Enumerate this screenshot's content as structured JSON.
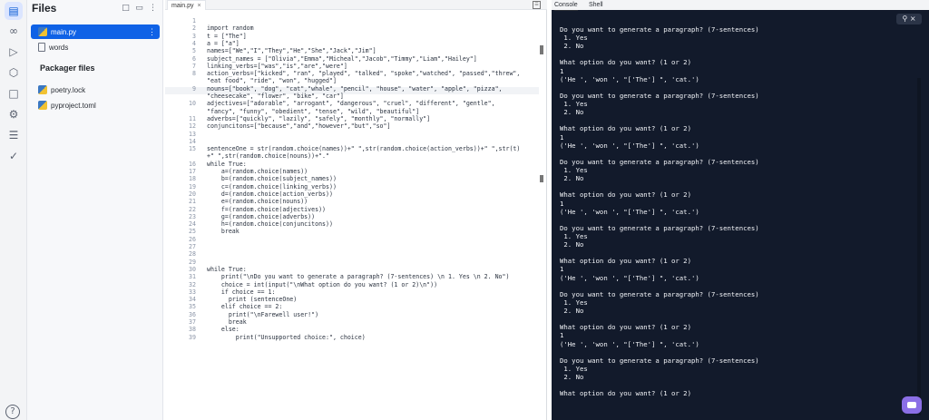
{
  "files": {
    "title": "Files",
    "items": [
      {
        "name": "main.py",
        "active": true
      },
      {
        "name": "words",
        "active": false
      }
    ],
    "packager_title": "Packager files",
    "packager_items": [
      {
        "name": "poetry.lock"
      },
      {
        "name": "pyproject.toml"
      }
    ]
  },
  "editor": {
    "tab_label": "main.py",
    "lines": [
      {
        "n": "1",
        "t": ""
      },
      {
        "n": "2",
        "t": "import random"
      },
      {
        "n": "3",
        "t": "t = [\"The\"]"
      },
      {
        "n": "4",
        "t": "a = [\"a\"]"
      },
      {
        "n": "5",
        "t": "names=[\"We\",\"I\",\"They\",\"He\",\"She\",\"Jack\",\"Jim\"]"
      },
      {
        "n": "6",
        "t": "subject_names = [\"Olivia\",\"Emma\",\"Micheal\",\"Jacob\",\"Timmy\",\"Liam\",\"Hailey\"]"
      },
      {
        "n": "7",
        "t": "linking_verbs=[\"was\",\"is\",\"are\",\"were\"]"
      },
      {
        "n": "8",
        "t": "action_verbs=[\"kicked\", \"ran\", \"played\", \"talked\", \"spoke\",\"watched\", \"passed\",\"threw\","
      },
      {
        "n": "",
        "t": "\"eat food\", \"ride\", \"won\", \"hugged\"]"
      },
      {
        "n": "9",
        "t": "nouns=[\"book\", \"dog\", \"cat\",\"whale\", \"pencil\", \"house\", \"water\", \"apple\", \"pizza\","
      },
      {
        "n": "",
        "t": "\"cheesecake\", \"flower\", \"bike\", \"car\"]"
      },
      {
        "n": "10",
        "t": "adjectives=[\"adorable\", \"arrogant\", \"dangerous\", \"cruel\", \"different\", \"gentle\","
      },
      {
        "n": "",
        "t": "\"fancy\", \"funny\", \"obedient\", \"tense\", \"wild\", \"beautiful\"]"
      },
      {
        "n": "11",
        "t": "adverbs=[\"quickly\", \"lazily\", \"safely\", \"monthly\", \"normally\"]"
      },
      {
        "n": "12",
        "t": "conjuncitons=[\"because\",\"and\",\"however\",\"but\",\"so\"]"
      },
      {
        "n": "13",
        "t": ""
      },
      {
        "n": "14",
        "t": ""
      },
      {
        "n": "15",
        "t": "sentenceOne = str(random.choice(names))+\" \",str(random.choice(action_verbs))+\" \",str(t)"
      },
      {
        "n": "",
        "t": "+\" \",str(random.choice(nouns))+\".\""
      },
      {
        "n": "16",
        "t": "while True:"
      },
      {
        "n": "17",
        "t": "    a=(random.choice(names))"
      },
      {
        "n": "18",
        "t": "    b=(random.choice(subject_names))"
      },
      {
        "n": "19",
        "t": "    c=(random.choice(linking_verbs))"
      },
      {
        "n": "20",
        "t": "    d=(random.choice(action_verbs))"
      },
      {
        "n": "21",
        "t": "    e=(random.choice(nouns))"
      },
      {
        "n": "22",
        "t": "    f=(random.choice(adjectives))"
      },
      {
        "n": "23",
        "t": "    g=(random.choice(adverbs))"
      },
      {
        "n": "24",
        "t": "    h=(random.choice(conjuncitons))"
      },
      {
        "n": "25",
        "t": "    break"
      },
      {
        "n": "26",
        "t": ""
      },
      {
        "n": "27",
        "t": ""
      },
      {
        "n": "28",
        "t": ""
      },
      {
        "n": "29",
        "t": ""
      },
      {
        "n": "30",
        "t": "while True:"
      },
      {
        "n": "31",
        "t": "    print(\"\\nDo you want to generate a paragraph? (7-sentences) \\n 1. Yes \\n 2. No\")"
      },
      {
        "n": "32",
        "t": "    choice = int(input(\"\\nWhat option do you want? (1 or 2)\\n\"))"
      },
      {
        "n": "33",
        "t": "    if choice == 1:"
      },
      {
        "n": "34",
        "t": "      print (sentenceOne)"
      },
      {
        "n": "35",
        "t": "    elif choice == 2:"
      },
      {
        "n": "36",
        "t": "      print(\"\\nFarewell user!\")"
      },
      {
        "n": "37",
        "t": "      break"
      },
      {
        "n": "38",
        "t": "    else:"
      },
      {
        "n": "39",
        "t": "        print(\"Unsupported choice:\", choice)"
      }
    ]
  },
  "console": {
    "tabs": [
      "Console",
      "Shell"
    ],
    "output": [
      "Do you want to generate a paragraph? (7-sentences)",
      " 1. Yes",
      " 2. No",
      "",
      "What option do you want? (1 or 2)",
      "1",
      "('He ', 'won ', \"['The'] \", 'cat.')",
      "",
      "Do you want to generate a paragraph? (7-sentences)",
      " 1. Yes",
      " 2. No",
      "",
      "What option do you want? (1 or 2)",
      "1",
      "('He ', 'won ', \"['The'] \", 'cat.')",
      "",
      "Do you want to generate a paragraph? (7-sentences)",
      " 1. Yes",
      " 2. No",
      "",
      "What option do you want? (1 or 2)",
      "1",
      "('He ', 'won ', \"['The'] \", 'cat.')",
      "",
      "Do you want to generate a paragraph? (7-sentences)",
      " 1. Yes",
      " 2. No",
      "",
      "What option do you want? (1 or 2)",
      "1",
      "('He ', 'won ', \"['The'] \", 'cat.')",
      "",
      "Do you want to generate a paragraph? (7-sentences)",
      " 1. Yes",
      " 2. No",
      "",
      "What option do you want? (1 or 2)",
      "1",
      "('He ', 'won ', \"['The'] \", 'cat.')",
      "",
      "Do you want to generate a paragraph? (7-sentences)",
      " 1. Yes",
      " 2. No",
      "",
      "What option do you want? (1 or 2)"
    ]
  }
}
